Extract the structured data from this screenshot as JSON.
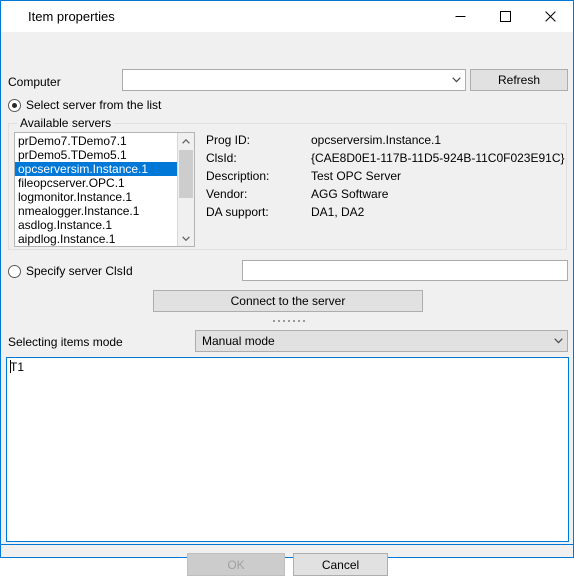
{
  "window": {
    "title": "Item properties",
    "accent_color": "#0078d7",
    "face_color": "#f0f0f0",
    "caption_buttons": [
      {
        "name": "minimize",
        "glyph": "minimize-icon"
      },
      {
        "name": "maximize",
        "glyph": "maximize-icon"
      },
      {
        "name": "close",
        "glyph": "close-icon"
      }
    ]
  },
  "computer": {
    "label": "Computer",
    "combo_value": "",
    "combo_placeholder": "",
    "refresh_label": "Refresh"
  },
  "mode_select": {
    "from_list": {
      "label": "Select server from the list",
      "selected": true
    },
    "specify_clsid": {
      "label": "Specify server ClsId",
      "selected": false,
      "input_value": "",
      "input_placeholder": ""
    }
  },
  "available_servers": {
    "group_title": "Available servers",
    "items": [
      "prDemo7.TDemo7.1",
      "prDemo5.TDemo5.1",
      "opcserversim.Instance.1",
      "fileopcserver.OPC.1",
      "logmonitor.Instance.1",
      "nmealogger.Instance.1",
      "asdlog.Instance.1",
      "aipdlog.Instance.1"
    ],
    "selected_index": 2,
    "selection_color": "#0078d7"
  },
  "server_properties": [
    {
      "label": "Prog ID:",
      "value": "opcserversim.Instance.1"
    },
    {
      "label": "ClsId:",
      "value": "{CAE8D0E1-117B-11D5-924B-11C0F023E91C}"
    },
    {
      "label": "Description:",
      "value": "Test OPC Server"
    },
    {
      "label": "Vendor:",
      "value": "AGG Software"
    },
    {
      "label": "DA support:",
      "value": "DA1, DA2"
    }
  ],
  "connect": {
    "label": "Connect to the server",
    "dot_count": 7
  },
  "items_mode": {
    "label": "Selecting items mode",
    "value": "Manual mode"
  },
  "items_editor": {
    "value": "T1"
  },
  "footer": {
    "ok_label": "OK",
    "ok_disabled": true,
    "cancel_label": "Cancel"
  }
}
